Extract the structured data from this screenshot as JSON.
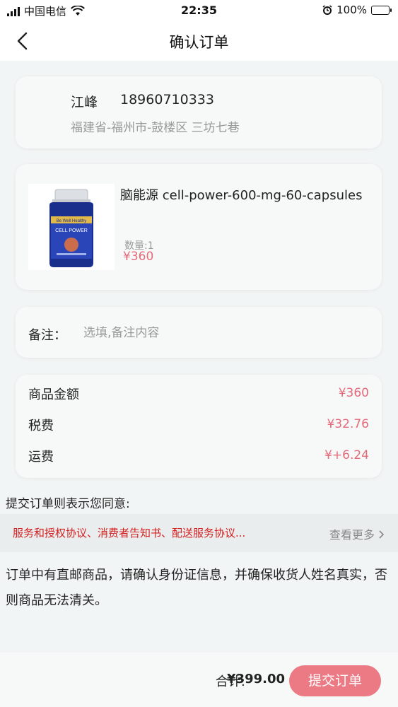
{
  "status_bar": {
    "carrier": "中国电信",
    "time": "22:35",
    "battery_percent": "100%"
  },
  "header": {
    "title": "确认订单"
  },
  "address": {
    "name": "江峰",
    "phone": "18960710333",
    "detail": "福建省-福州市-鼓楼区 三坊七巷"
  },
  "product": {
    "name": "脑能源 cell-power-600-mg-60-capsules",
    "quantity": "数量:1",
    "price": "¥360",
    "label_text": "CELL POWER",
    "brand_text": "Be Well Healthy"
  },
  "remark": {
    "label": "备注：",
    "placeholder": "选填,备注内容"
  },
  "summary": {
    "rows": [
      {
        "label": "商品金额",
        "value": "¥360"
      },
      {
        "label": "税费",
        "value": "¥32.76"
      },
      {
        "label": "运费",
        "value": "¥+6.24"
      }
    ]
  },
  "agreement": {
    "title": "提交订单则表示您同意:",
    "links": "服务和授权协议、消费者告知书、配送服务协议...",
    "more": "查看更多"
  },
  "notice": "订单中有直邮商品，请确认身份证信息，并确保收货人姓名真实，否则商品无法清关。",
  "footer": {
    "total_label": "合计:",
    "total_value": "¥399.00",
    "submit_label": "提交订单"
  },
  "colors": {
    "accent": "#ec7a84",
    "price": "#e46b7a",
    "link_red": "#d42020"
  }
}
